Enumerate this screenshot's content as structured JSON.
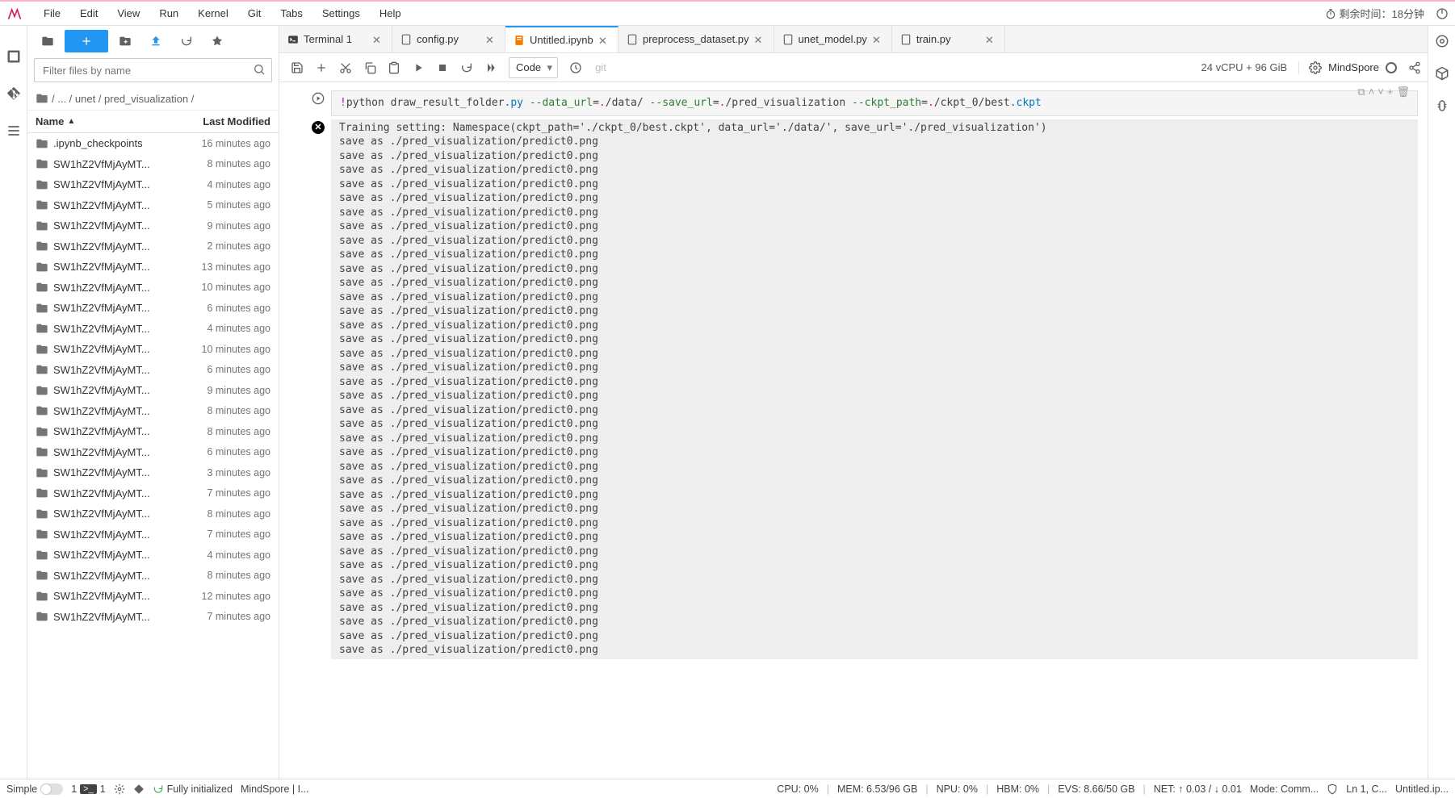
{
  "menu": {
    "items": [
      "File",
      "Edit",
      "View",
      "Run",
      "Kernel",
      "Git",
      "Tabs",
      "Settings",
      "Help"
    ],
    "time_remaining": "剩余时间：18分钟"
  },
  "filter": {
    "placeholder": "Filter files by name"
  },
  "breadcrumb": {
    "parts": [
      "",
      "/",
      "...",
      "/",
      "unet",
      "/",
      "pred_visualization",
      "/"
    ],
    "folder_icon": "folder"
  },
  "file_header": {
    "name": "Name",
    "modified": "Last Modified"
  },
  "files": [
    {
      "name": ".ipynb_checkpoints",
      "modified": "16 minutes ago"
    },
    {
      "name": "SW1hZ2VfMjAyMT...",
      "modified": "8 minutes ago"
    },
    {
      "name": "SW1hZ2VfMjAyMT...",
      "modified": "4 minutes ago"
    },
    {
      "name": "SW1hZ2VfMjAyMT...",
      "modified": "5 minutes ago"
    },
    {
      "name": "SW1hZ2VfMjAyMT...",
      "modified": "9 minutes ago"
    },
    {
      "name": "SW1hZ2VfMjAyMT...",
      "modified": "2 minutes ago"
    },
    {
      "name": "SW1hZ2VfMjAyMT...",
      "modified": "13 minutes ago"
    },
    {
      "name": "SW1hZ2VfMjAyMT...",
      "modified": "10 minutes ago"
    },
    {
      "name": "SW1hZ2VfMjAyMT...",
      "modified": "6 minutes ago"
    },
    {
      "name": "SW1hZ2VfMjAyMT...",
      "modified": "4 minutes ago"
    },
    {
      "name": "SW1hZ2VfMjAyMT...",
      "modified": "10 minutes ago"
    },
    {
      "name": "SW1hZ2VfMjAyMT...",
      "modified": "6 minutes ago"
    },
    {
      "name": "SW1hZ2VfMjAyMT...",
      "modified": "9 minutes ago"
    },
    {
      "name": "SW1hZ2VfMjAyMT...",
      "modified": "8 minutes ago"
    },
    {
      "name": "SW1hZ2VfMjAyMT...",
      "modified": "8 minutes ago"
    },
    {
      "name": "SW1hZ2VfMjAyMT...",
      "modified": "6 minutes ago"
    },
    {
      "name": "SW1hZ2VfMjAyMT...",
      "modified": "3 minutes ago"
    },
    {
      "name": "SW1hZ2VfMjAyMT...",
      "modified": "7 minutes ago"
    },
    {
      "name": "SW1hZ2VfMjAyMT...",
      "modified": "8 minutes ago"
    },
    {
      "name": "SW1hZ2VfMjAyMT...",
      "modified": "7 minutes ago"
    },
    {
      "name": "SW1hZ2VfMjAyMT...",
      "modified": "4 minutes ago"
    },
    {
      "name": "SW1hZ2VfMjAyMT...",
      "modified": "8 minutes ago"
    },
    {
      "name": "SW1hZ2VfMjAyMT...",
      "modified": "12 minutes ago"
    },
    {
      "name": "SW1hZ2VfMjAyMT...",
      "modified": "7 minutes ago"
    }
  ],
  "tabs": [
    {
      "label": "Terminal 1",
      "type": "terminal",
      "active": false
    },
    {
      "label": "config.py",
      "type": "python",
      "active": false
    },
    {
      "label": "Untitled.ipynb",
      "type": "notebook",
      "active": true
    },
    {
      "label": "preprocess_dataset.py",
      "type": "python",
      "active": false
    },
    {
      "label": "unet_model.py",
      "type": "python",
      "active": false
    },
    {
      "label": "train.py",
      "type": "python",
      "active": false
    }
  ],
  "nb_toolbar": {
    "cell_type": "Code",
    "git": "git",
    "resources": "24 vCPU + 96 GiB",
    "kernel": "MindSpore"
  },
  "code_cell": {
    "magic": "!",
    "cmd": "python draw_result_folder",
    "ext1": ".py ",
    "arg1": "--data_url",
    "eq": "=",
    "path1": ".",
    "path1b": "/data/ ",
    "arg2": "--save_url",
    "path2": ".",
    "path2b": "/pred_visualization ",
    "arg3": "--ckpt_path",
    "path3": ".",
    "path3b": "/ckpt_0/best",
    "ext2": ".ckpt"
  },
  "output_header": "Training setting: Namespace(ckpt_path='./ckpt_0/best.ckpt', data_url='./data/', save_url='./pred_visualization')",
  "output_line": "save as ./pred_visualization/predict0.png",
  "output_repeat": 37,
  "status": {
    "simple": "Simple",
    "one_a": "1",
    "one_b": "1",
    "init": "Fully initialized",
    "kernel": "MindSpore | I...",
    "cpu": "CPU: 0%",
    "mem": "MEM: 6.53/96 GB",
    "npu": "NPU: 0%",
    "hbm": "HBM: 0%",
    "evs": "EVS: 8.66/50 GB",
    "net": "NET: ↑ 0.03 / ↓ 0.01",
    "mode": "Mode: Comm...",
    "ln": "Ln 1, C...",
    "file": "Untitled.ip..."
  }
}
